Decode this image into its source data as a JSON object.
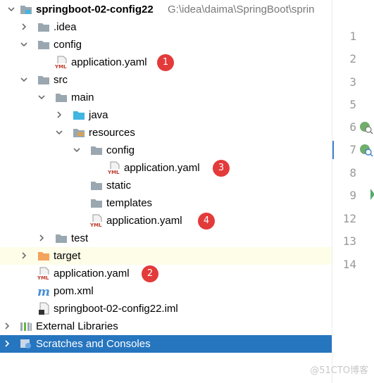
{
  "project": {
    "name": "springboot-02-config22",
    "path": "G:\\idea\\daima\\SpringBoot\\sprin"
  },
  "tree": [
    {
      "label": "springboot-02-config22",
      "icon": "module-folder-icon",
      "arrow": "down"
    },
    {
      "label": ".idea",
      "icon": "folder-icon",
      "arrow": "right"
    },
    {
      "label": "config",
      "icon": "folder-icon",
      "arrow": "down"
    },
    {
      "label": "application.yaml",
      "icon": "yml-file-icon",
      "badge": "1"
    },
    {
      "label": "src",
      "icon": "folder-icon",
      "arrow": "down"
    },
    {
      "label": "main",
      "icon": "folder-icon",
      "arrow": "down"
    },
    {
      "label": "java",
      "icon": "source-folder-icon",
      "arrow": "right"
    },
    {
      "label": "resources",
      "icon": "resources-folder-icon",
      "arrow": "down"
    },
    {
      "label": "config",
      "icon": "folder-icon",
      "arrow": "down"
    },
    {
      "label": "application.yaml",
      "icon": "yml-file-icon",
      "badge": "3"
    },
    {
      "label": "static",
      "icon": "folder-icon"
    },
    {
      "label": "templates",
      "icon": "folder-icon"
    },
    {
      "label": "application.yaml",
      "icon": "yml-file-icon",
      "badge": "4"
    },
    {
      "label": "test",
      "icon": "folder-icon",
      "arrow": "right"
    },
    {
      "label": "target",
      "icon": "excluded-folder-icon",
      "arrow": "right"
    },
    {
      "label": "application.yaml",
      "icon": "yml-file-icon",
      "badge": "2"
    },
    {
      "label": "pom.xml",
      "icon": "maven-icon"
    },
    {
      "label": "springboot-02-config22.iml",
      "icon": "iml-file-icon"
    },
    {
      "label": "External Libraries",
      "icon": "library-icon",
      "arrow": "right"
    },
    {
      "label": "Scratches and Consoles",
      "icon": "scratches-icon",
      "arrow": "right"
    }
  ],
  "line_numbers": [
    "1",
    "2",
    "3",
    "5",
    "6",
    "7",
    "8",
    "9",
    "12",
    "13",
    "14"
  ],
  "watermark": "@51CTO博客",
  "colors": {
    "selection": "#2675bf",
    "highlight_row": "#fefde8",
    "badge": "#e33a3a",
    "folder": "#9aa7b0",
    "source_folder": "#40b6e0",
    "excluded_folder": "#f4a35a"
  }
}
